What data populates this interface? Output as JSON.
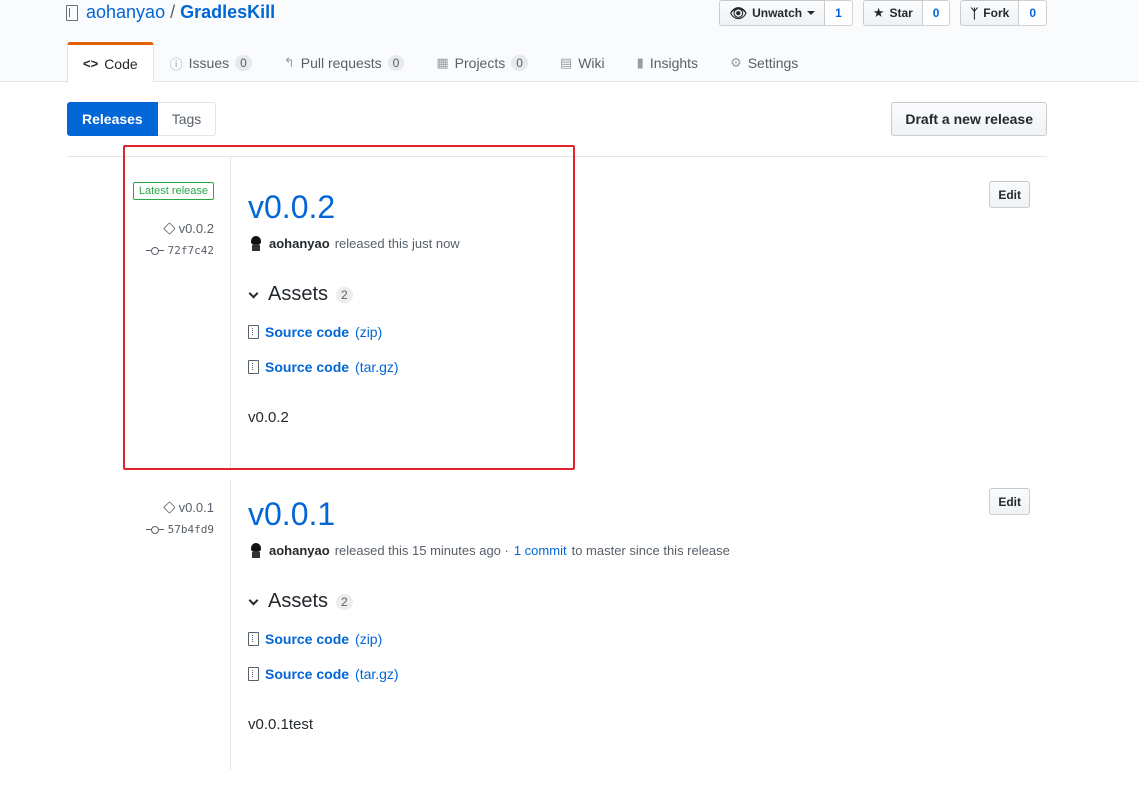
{
  "repo": {
    "owner": "aohanyao",
    "separator": "/",
    "name": "GradlesKill"
  },
  "actions": {
    "watch": {
      "label": "Unwatch",
      "count": "1"
    },
    "star": {
      "label": "Star",
      "count": "0"
    },
    "fork": {
      "label": "Fork",
      "count": "0"
    }
  },
  "tabs": [
    {
      "label": "Code",
      "icon": "code-icon",
      "selected": true
    },
    {
      "label": "Issues",
      "icon": "issue-icon",
      "counter": "0"
    },
    {
      "label": "Pull requests",
      "icon": "pull-request-icon",
      "counter": "0"
    },
    {
      "label": "Projects",
      "icon": "project-icon",
      "counter": "0"
    },
    {
      "label": "Wiki",
      "icon": "book-icon"
    },
    {
      "label": "Insights",
      "icon": "graph-icon"
    },
    {
      "label": "Settings",
      "icon": "gear-icon"
    }
  ],
  "subnav": {
    "releases": "Releases",
    "tags": "Tags",
    "draft": "Draft a new release"
  },
  "releases": [
    {
      "latest_label": "Latest release",
      "tag": "v0.0.2",
      "commit": "72f7c42",
      "title": "v0.0.2",
      "author": "aohanyao",
      "released_text": "released this just now",
      "assets_label": "Assets",
      "assets_count": "2",
      "assets": [
        {
          "name": "Source code",
          "ext": "(zip)"
        },
        {
          "name": "Source code",
          "ext": "(tar.gz)"
        }
      ],
      "notes": "v0.0.2",
      "edit": "Edit"
    },
    {
      "tag": "v0.0.1",
      "commit": "57b4fd9",
      "title": "v0.0.1",
      "author": "aohanyao",
      "released_text": "released this 15 minutes ago ·",
      "commits_link": "1 commit",
      "since_text": "to master since this release",
      "assets_label": "Assets",
      "assets_count": "2",
      "assets": [
        {
          "name": "Source code",
          "ext": "(zip)"
        },
        {
          "name": "Source code",
          "ext": "(tar.gz)"
        }
      ],
      "notes": "v0.0.1test",
      "edit": "Edit"
    }
  ],
  "annotation_color": "#e0262b"
}
